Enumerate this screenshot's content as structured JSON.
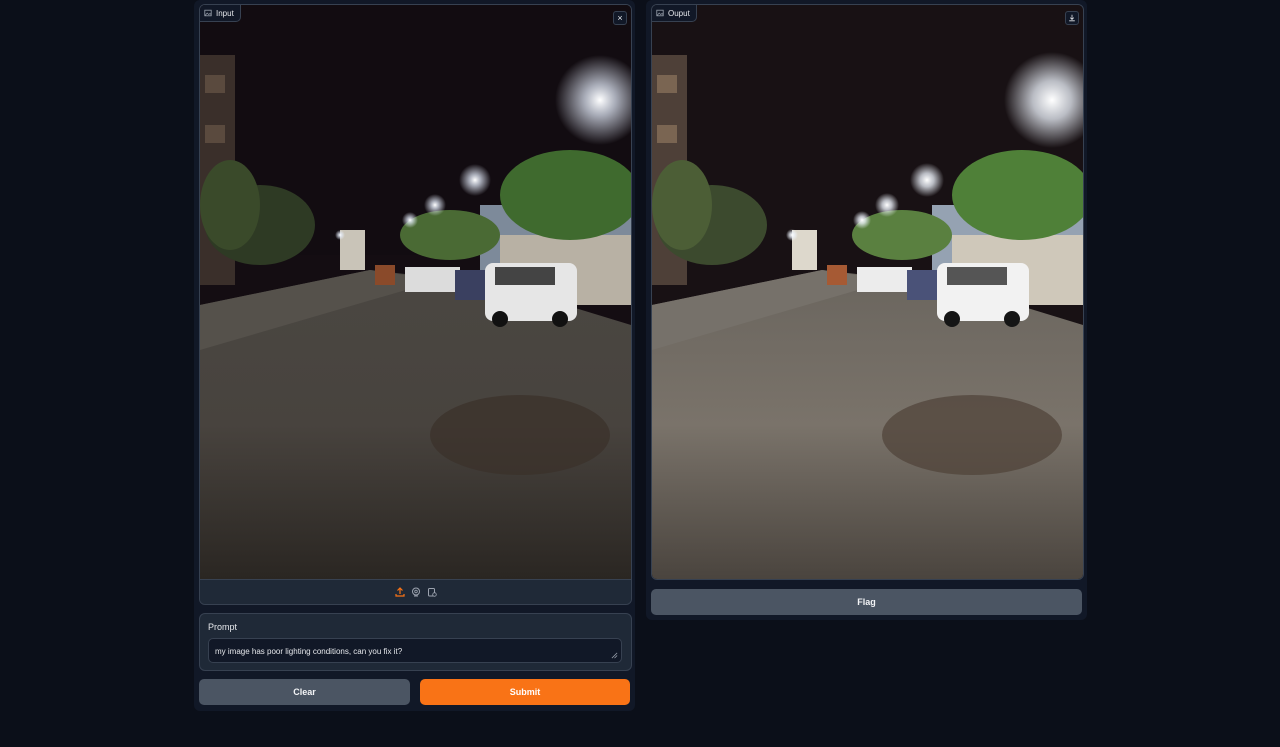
{
  "input_panel": {
    "label": "Input",
    "image_alt": "Night street scene with parked cars and street lights",
    "clear_icon": "close-icon",
    "source_icons": [
      "upload-icon",
      "webcam-icon",
      "clipboard-icon"
    ]
  },
  "output_panel": {
    "label": "Ouput",
    "download_icon": "download-icon"
  },
  "prompt": {
    "label": "Prompt",
    "value": "my image has poor lighting conditions, can you fix it?"
  },
  "buttons": {
    "clear": "Clear",
    "submit": "Submit",
    "flag": "Flag"
  },
  "colors": {
    "background": "#0b0f19",
    "panel": "#1f2937",
    "accent": "#f97316",
    "secondary_button": "#4b5563"
  }
}
